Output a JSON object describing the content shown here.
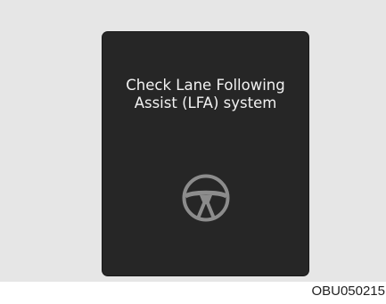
{
  "warning": {
    "line1": "Check Lane Following",
    "line2": "Assist (LFA) system",
    "icon": "steering-wheel-icon",
    "icon_color": "#8c8c8c",
    "display_color": "#262626",
    "text_color": "#f2f2f2"
  },
  "figure_code": "OBU050215"
}
